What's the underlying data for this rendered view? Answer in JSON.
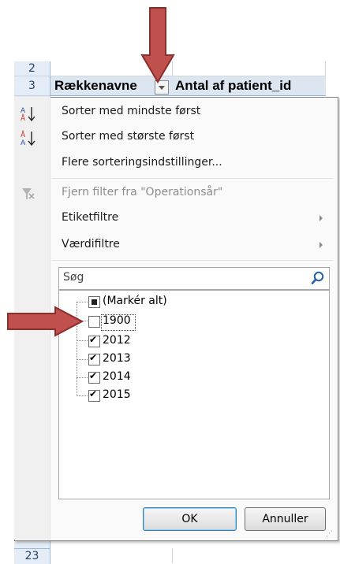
{
  "sheet": {
    "rows": {
      "r2": "2",
      "r3": "3",
      "r23": "23"
    },
    "header": {
      "col_a": "Rækkenavne",
      "col_b": "Antal af patient_id"
    }
  },
  "menu": {
    "sort_asc": "Sorter med mindste først",
    "sort_desc": "Sorter med største først",
    "more_sort": "Flere sorteringsindstillinger...",
    "clear_filter": "Fjern filter fra \"Operationsår\"",
    "label_filters": "Etiketfiltre",
    "value_filters": "Værdifiltre"
  },
  "search": {
    "placeholder": "Søg"
  },
  "list": {
    "items": [
      {
        "label": "(Markér alt)",
        "state": "partial"
      },
      {
        "label": "1900",
        "state": "unchecked"
      },
      {
        "label": "2012",
        "state": "checked"
      },
      {
        "label": "2013",
        "state": "checked"
      },
      {
        "label": "2014",
        "state": "checked"
      },
      {
        "label": "2015",
        "state": "checked"
      }
    ]
  },
  "buttons": {
    "ok": "OK",
    "cancel": "Annuller"
  },
  "colors": {
    "arrow": "#c0504d",
    "header_bg": "#dce6f1"
  }
}
